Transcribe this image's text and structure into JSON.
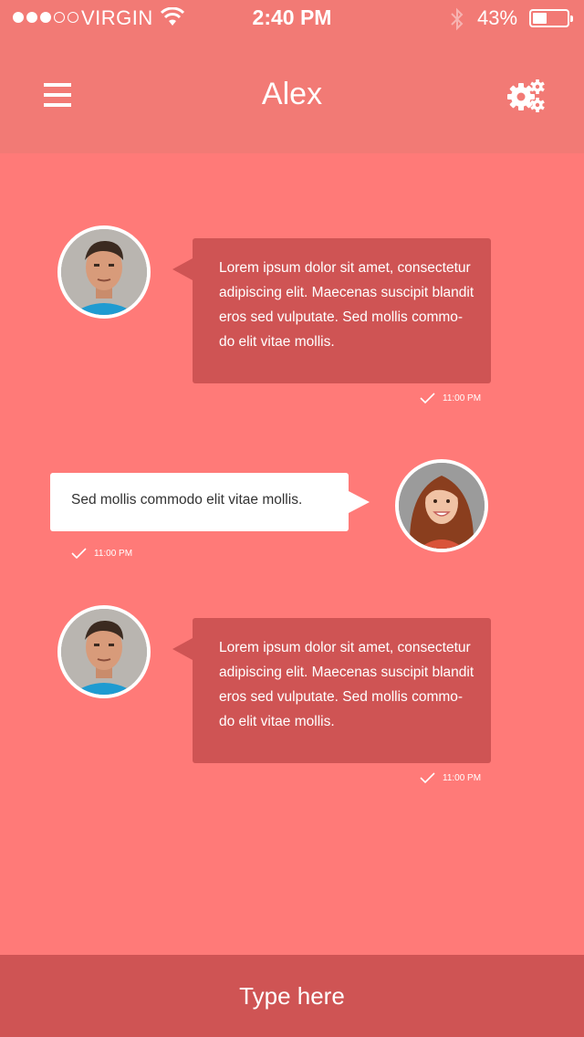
{
  "status_bar": {
    "carrier": "VIRGIN",
    "time": "2:40 PM",
    "battery_percent": "43%",
    "battery_level": 0.43,
    "signal_bars_filled": 3,
    "signal_bars_total": 5,
    "icons": [
      "wifi-icon",
      "bluetooth-icon",
      "battery-icon"
    ]
  },
  "nav": {
    "title": "Alex",
    "left_icon": "hamburger-menu-icon",
    "right_icon": "settings-gears-icon"
  },
  "messages": [
    {
      "sender": "incoming",
      "text": "Lorem ipsum dolor sit amet, consectetur adipiscing elit. Maecenas suscipit blandit eros sed vulputate. Sed mollis commo-do elit vitae mollis.",
      "time": "11:00 PM"
    },
    {
      "sender": "outgoing",
      "text": "Sed mollis commodo elit vitae mollis.",
      "time": "11:00 PM"
    },
    {
      "sender": "incoming",
      "text": "Lorem ipsum dolor sit amet, consectetur adipiscing elit. Maecenas suscipit blandit eros sed vulputate. Sed mollis commo-do elit vitae mollis.",
      "time": "11:00 PM"
    }
  ],
  "composer": {
    "placeholder": "Type here"
  },
  "colors": {
    "background": "#ff7a78",
    "header": "#f27a75",
    "incoming_bubble": "#cf5454",
    "outgoing_bubble": "#ffffff",
    "composer": "#cf5454"
  }
}
